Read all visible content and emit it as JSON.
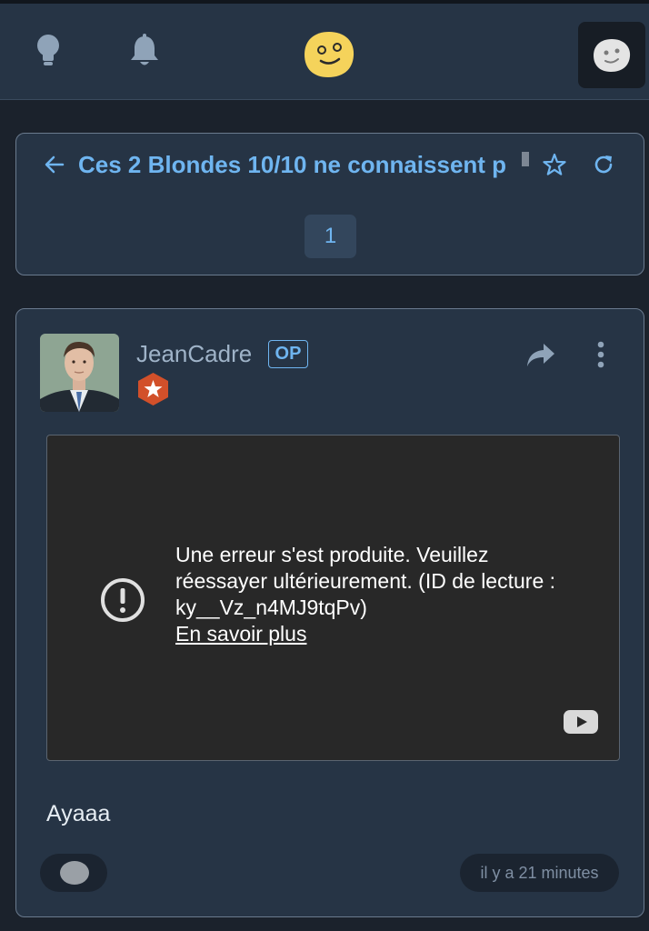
{
  "topbar": {
    "icons": [
      "lightbulb-icon",
      "bell-icon",
      "smiley-logo-icon",
      "user-avatar-icon"
    ],
    "logo_color": "#f5d35b"
  },
  "topic": {
    "title": "Ces 2 Blondes 10/10 ne connaissent p",
    "current_page": "1",
    "accent_color": "#6fb5f0"
  },
  "post": {
    "author": "JeanCadre",
    "op_badge": "OP",
    "rank_badge_color": "#d2502a",
    "embed": {
      "error_message": "Une erreur s'est produite. Veuillez réessayer ultérieurement. (ID de lecture : ky__Vz_n4MJ9tqPv)",
      "learn_more": "En savoir plus"
    },
    "body": "Ayaaa",
    "timestamp": "il y a 21 minutes"
  }
}
